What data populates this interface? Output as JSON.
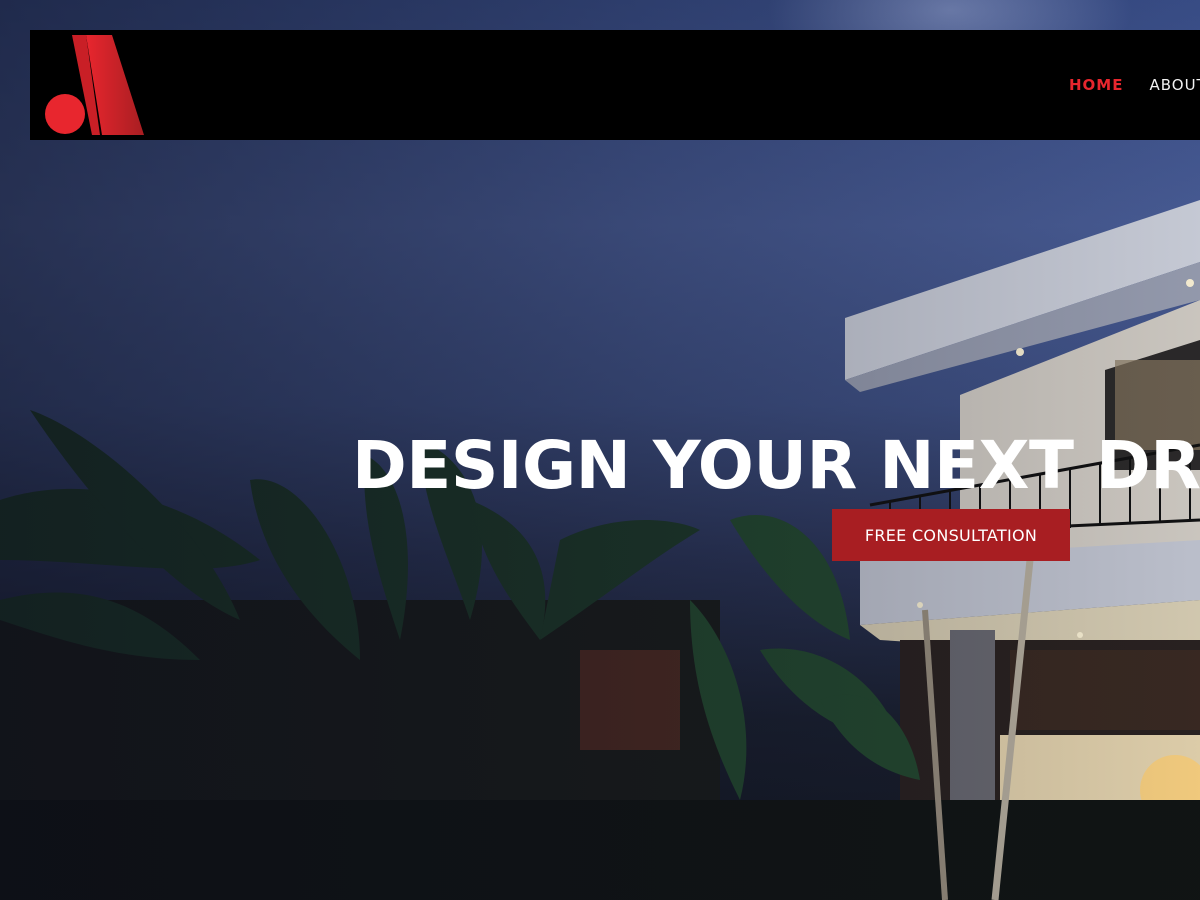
{
  "brand": {
    "logo_icon": "brand-logo-a-dot",
    "colors": {
      "primary_red": "#e8262e",
      "dark_red": "#a81e22",
      "header_bg": "#000000"
    }
  },
  "nav": {
    "items": [
      {
        "label": "HOME",
        "active": true
      },
      {
        "label": "ABOUT",
        "active": false
      }
    ]
  },
  "hero": {
    "headline": "DESIGN YOUR NEXT DRE",
    "cta_label": "FREE CONSULTATION"
  }
}
